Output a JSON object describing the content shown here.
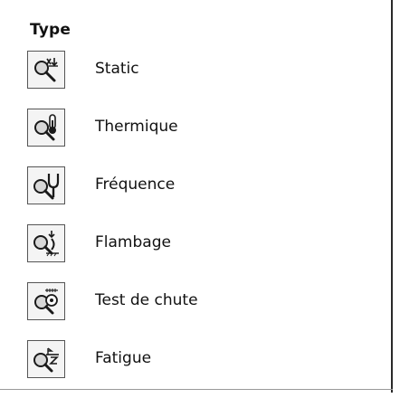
{
  "type_panel": {
    "title": "Type",
    "options": [
      {
        "label": "Static",
        "icon": "static-study-icon"
      },
      {
        "label": "Thermique",
        "icon": "thermal-study-icon"
      },
      {
        "label": "Fréquence",
        "icon": "frequency-study-icon"
      },
      {
        "label": "Flambage",
        "icon": "buckling-study-icon"
      },
      {
        "label": "Test de chute",
        "icon": "drop-test-study-icon"
      },
      {
        "label": "Fatigue",
        "icon": "fatigue-study-icon"
      }
    ]
  },
  "colors": {
    "icon_border": "#555555",
    "icon_background": "#f4f4f4",
    "text": "#111111",
    "panel_border": "#2a2a2a"
  }
}
